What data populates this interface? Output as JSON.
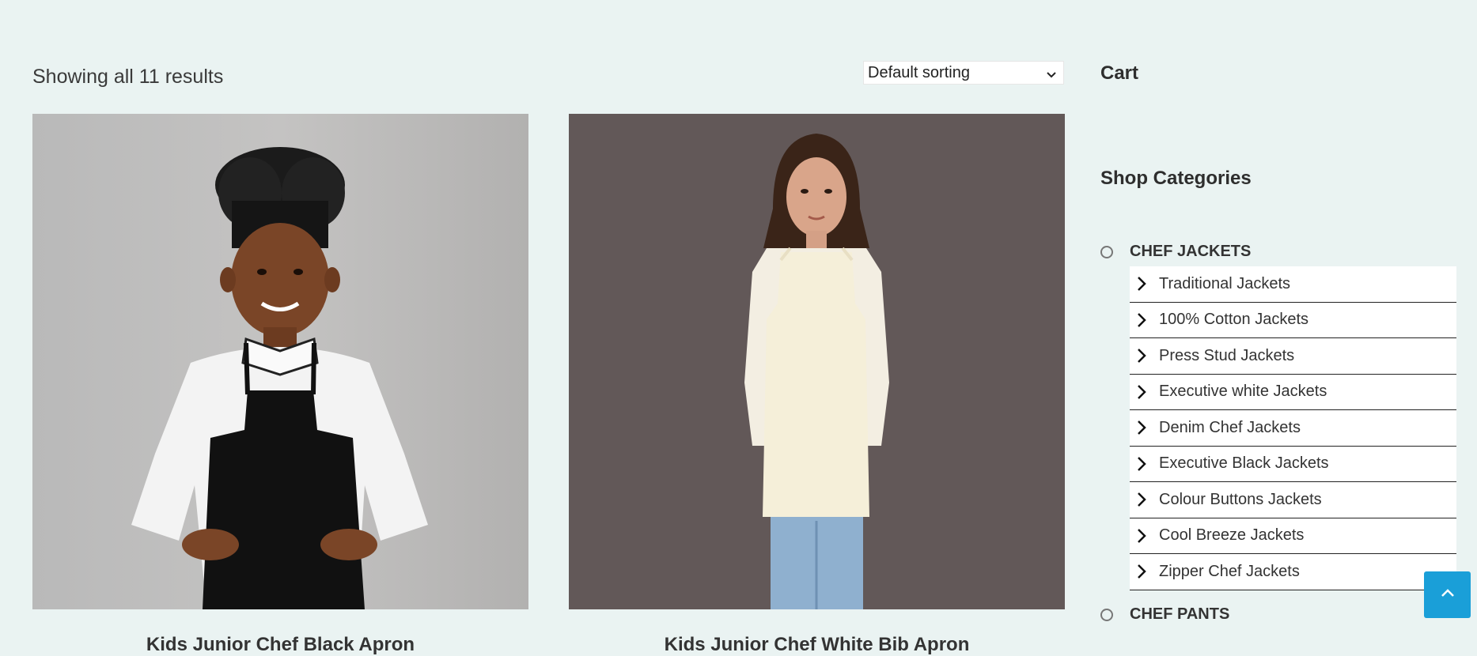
{
  "shop": {
    "results_text": "Showing all 11 results",
    "sorting": {
      "selected": "Default sorting"
    }
  },
  "products": [
    {
      "title": "Kids Junior Chef Black Apron"
    },
    {
      "title": "Kids Junior Chef White Bib Apron"
    }
  ],
  "sidebar": {
    "cart_title": "Cart",
    "categories_title": "Shop Categories",
    "categories": [
      {
        "label": "CHEF JACKETS",
        "children": [
          "Traditional Jackets",
          "100% Cotton Jackets",
          "Press Stud Jackets",
          "Executive white Jackets",
          "Denim Chef Jackets",
          "Executive Black Jackets",
          "Colour Buttons Jackets",
          "Cool Breeze Jackets",
          "Zipper Chef Jackets"
        ]
      },
      {
        "label": "CHEF PANTS"
      }
    ]
  },
  "colors": {
    "page_bg": "#eaf3f2",
    "accent": "#1a9fd8"
  },
  "icons": [
    "chevron-down-icon",
    "chevron-right-icon",
    "radio-circle-icon",
    "chevron-up-icon"
  ]
}
